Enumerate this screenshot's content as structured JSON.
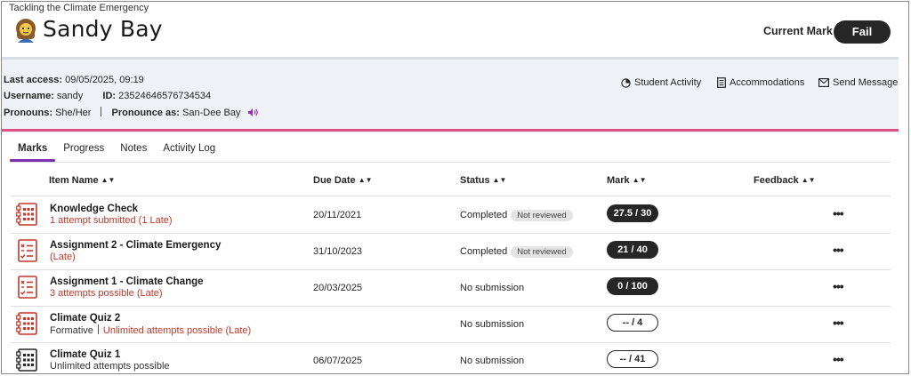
{
  "course": "Tackling the Climate Emergency",
  "student": {
    "name": "Sandy Bay",
    "last_access_label": "Last access:",
    "last_access": "09/05/2025, 09:19",
    "username_label": "Username:",
    "username": "sandy",
    "id_label": "ID:",
    "id": "23524646576734534",
    "pronouns_label": "Pronouns:",
    "pronouns": "She/Her",
    "pronounce_label": "Pronounce as:",
    "pronounce": "San-Dee Bay"
  },
  "current_mark": {
    "label": "Current Mark",
    "value": "Fail"
  },
  "actions": {
    "student_activity": "Student Activity",
    "accommodations": "Accommodations",
    "send_message": "Send Message"
  },
  "tabs": [
    "Marks",
    "Progress",
    "Notes",
    "Activity Log"
  ],
  "table": {
    "headers": [
      "Item Name",
      "Due Date",
      "Status",
      "Mark",
      "Feedback"
    ],
    "rows": [
      {
        "icon": "test-icon",
        "title": "Knowledge Check",
        "sub_prefix": "",
        "sub": "1 attempt submitted (1 Late)",
        "due": "20/11/2021",
        "status": "Completed",
        "badge": "Not reviewed",
        "mark": "27.5 / 30",
        "mark_style": "dark"
      },
      {
        "icon": "assignment-icon",
        "title": "Assignment 2 - Climate Emergency",
        "sub_prefix": "",
        "sub": "(Late)",
        "due": "31/10/2023",
        "status": "Completed",
        "badge": "Not reviewed",
        "mark": "21 / 40",
        "mark_style": "dark"
      },
      {
        "icon": "assignment-icon",
        "title": "Assignment 1 - Climate Change",
        "sub_prefix": "",
        "sub": "3 attempts possible (Late)",
        "due": "20/03/2025",
        "status": "No submission",
        "badge": "",
        "mark": "0 / 100",
        "mark_style": "dark"
      },
      {
        "icon": "test-icon",
        "title": "Climate Quiz 2",
        "sub_prefix": "Formative",
        "sub": "Unlimited attempts possible (Late)",
        "due": "",
        "status": "No submission",
        "badge": "",
        "mark": "-- / 4",
        "mark_style": "light"
      },
      {
        "icon": "test-icon-dark",
        "title": "Climate Quiz 1",
        "sub_prefix": "Unlimited attempts possible",
        "sub": "",
        "due": "06/07/2025",
        "status": "No submission",
        "badge": "",
        "mark": "-- / 41",
        "mark_style": "light"
      }
    ],
    "more_label": "•••"
  },
  "colors": {
    "accent": "#7b2fb0",
    "late": "#c0392b",
    "divider": "#e2508a",
    "icon_red": "#c0392b"
  }
}
